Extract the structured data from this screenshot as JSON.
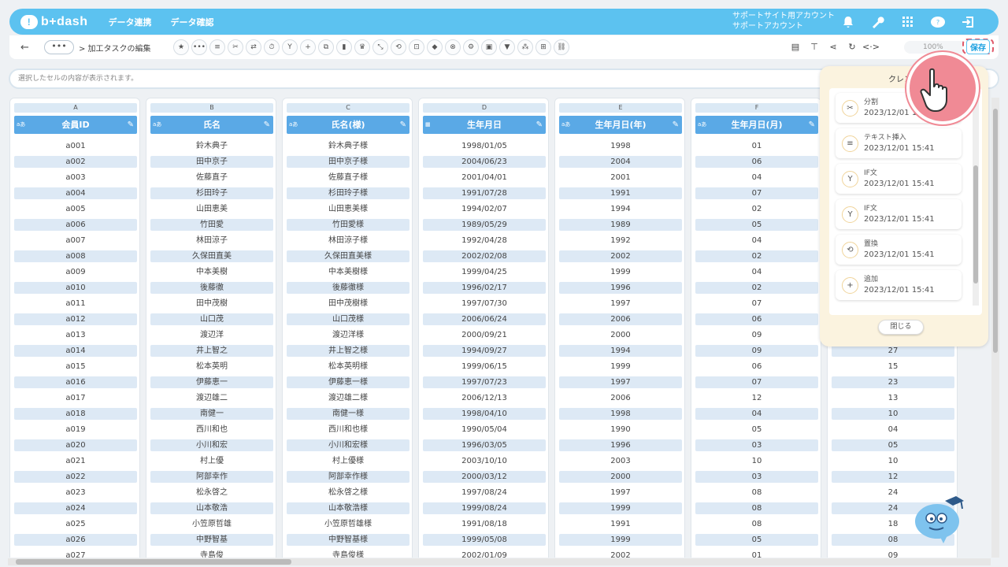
{
  "header": {
    "logo_text": "b+dash",
    "nav": [
      "データ連携",
      "データ確認"
    ],
    "account_line1": "サポートサイト用アカウント",
    "account_line2": "サポートアカウント",
    "icons": [
      "bell-icon",
      "wrench-icon",
      "grid-icon",
      "help-chat-icon",
      "logout-icon"
    ]
  },
  "toolbar": {
    "back": "←",
    "more": "•••",
    "title": "> 加工タスクの編集",
    "zoom_label": "100%",
    "save_label": "保存",
    "tool_icons": [
      "star",
      "dots",
      "text",
      "split",
      "swap",
      "timer",
      "branch",
      "plus",
      "copy",
      "trash",
      "crown",
      "shuffle",
      "repeat",
      "lock",
      "cube",
      "cancel",
      "tune",
      "frame",
      "filter",
      "group",
      "table",
      "link"
    ],
    "right_icons": [
      "clipboard",
      "flow",
      "share",
      "refresh",
      "code"
    ]
  },
  "cellbar": {
    "placeholder": "選択したセルの内容が表示されます。"
  },
  "columns": [
    {
      "letter": "A",
      "name": "会員ID",
      "type": "aあ"
    },
    {
      "letter": "B",
      "name": "氏名",
      "type": "aあ"
    },
    {
      "letter": "C",
      "name": "氏名(様)",
      "type": "aあ"
    },
    {
      "letter": "D",
      "name": "生年月日",
      "type": "cal"
    },
    {
      "letter": "E",
      "name": "生年月日(年)",
      "type": "aあ"
    },
    {
      "letter": "F",
      "name": "生年月日(月)",
      "type": "aあ"
    },
    {
      "letter": "G",
      "name": "",
      "type": ""
    }
  ],
  "rows": [
    [
      "a001",
      "鈴木典子",
      "鈴木典子様",
      "1998/01/05",
      "1998",
      "01",
      ""
    ],
    [
      "a002",
      "田中京子",
      "田中京子様",
      "2004/06/23",
      "2004",
      "06",
      ""
    ],
    [
      "a003",
      "佐藤直子",
      "佐藤直子様",
      "2001/04/01",
      "2001",
      "04",
      ""
    ],
    [
      "a004",
      "杉田玲子",
      "杉田玲子様",
      "1991/07/28",
      "1991",
      "07",
      ""
    ],
    [
      "a005",
      "山田恵美",
      "山田恵美様",
      "1994/02/07",
      "1994",
      "02",
      ""
    ],
    [
      "a006",
      "竹田愛",
      "竹田愛様",
      "1989/05/29",
      "1989",
      "05",
      ""
    ],
    [
      "a007",
      "林田涼子",
      "林田涼子様",
      "1992/04/28",
      "1992",
      "04",
      ""
    ],
    [
      "a008",
      "久保田直美",
      "久保田直美様",
      "2002/02/08",
      "2002",
      "02",
      ""
    ],
    [
      "a009",
      "中本美樹",
      "中本美樹様",
      "1999/04/25",
      "1999",
      "04",
      ""
    ],
    [
      "a010",
      "後藤徹",
      "後藤徹様",
      "1996/02/17",
      "1996",
      "02",
      ""
    ],
    [
      "a011",
      "田中茂樹",
      "田中茂樹様",
      "1997/07/30",
      "1997",
      "07",
      ""
    ],
    [
      "a012",
      "山口茂",
      "山口茂様",
      "2006/06/24",
      "2006",
      "06",
      ""
    ],
    [
      "a013",
      "渡辺洋",
      "渡辺洋様",
      "2000/09/21",
      "2000",
      "09",
      ""
    ],
    [
      "a014",
      "井上智之",
      "井上智之様",
      "1994/09/27",
      "1994",
      "09",
      "27"
    ],
    [
      "a015",
      "松本英明",
      "松本英明様",
      "1999/06/15",
      "1999",
      "06",
      "15"
    ],
    [
      "a016",
      "伊藤恵一",
      "伊藤恵一様",
      "1997/07/23",
      "1997",
      "07",
      "23"
    ],
    [
      "a017",
      "渡辺雄二",
      "渡辺雄二様",
      "2006/12/13",
      "2006",
      "12",
      "13"
    ],
    [
      "a018",
      "南健一",
      "南健一様",
      "1998/04/10",
      "1998",
      "04",
      "10"
    ],
    [
      "a019",
      "西川和也",
      "西川和也様",
      "1990/05/04",
      "1990",
      "05",
      "04"
    ],
    [
      "a020",
      "小川和宏",
      "小川和宏様",
      "1996/03/05",
      "1996",
      "03",
      "05"
    ],
    [
      "a021",
      "村上優",
      "村上優様",
      "2003/10/10",
      "2003",
      "10",
      "10"
    ],
    [
      "a022",
      "阿部幸作",
      "阿部幸作様",
      "2000/03/12",
      "2000",
      "03",
      "12"
    ],
    [
      "a023",
      "松永啓之",
      "松永啓之様",
      "1997/08/24",
      "1997",
      "08",
      "24"
    ],
    [
      "a024",
      "山本敬浩",
      "山本敬浩様",
      "1999/08/24",
      "1999",
      "08",
      "24"
    ],
    [
      "a025",
      "小笠原哲雄",
      "小笠原哲雄様",
      "1991/08/18",
      "1991",
      "08",
      "18"
    ],
    [
      "a026",
      "中野智基",
      "中野智基様",
      "1999/05/08",
      "1999",
      "05",
      "08"
    ],
    [
      "a027",
      "寺島俊",
      "寺島俊様",
      "2002/01/09",
      "2002",
      "01",
      "09"
    ]
  ],
  "panel": {
    "title": "クレンジ",
    "close_label": "閉じる",
    "history": [
      {
        "name": "分割",
        "date": "2023/12/01 15:41",
        "icon": "split"
      },
      {
        "name": "テキスト挿入",
        "date": "2023/12/01 15:41",
        "icon": "text"
      },
      {
        "name": "IF文",
        "date": "2023/12/01 15:41",
        "icon": "branch"
      },
      {
        "name": "IF文",
        "date": "2023/12/01 15:41",
        "icon": "branch"
      },
      {
        "name": "置換",
        "date": "2023/12/01 15:41",
        "icon": "repeat"
      },
      {
        "name": "追加",
        "date": "2023/12/01 15:41",
        "icon": "plus"
      }
    ]
  },
  "colors": {
    "brand": "#5cc2f0",
    "header_col": "#5aa9e6",
    "alt_row": "#dde9f5",
    "highlight": "#f08a95"
  }
}
